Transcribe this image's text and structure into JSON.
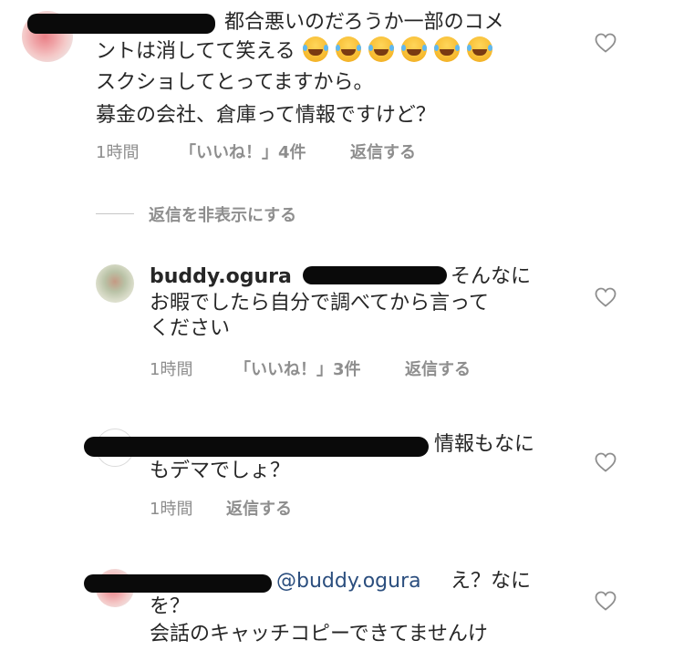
{
  "comment1": {
    "text_line1": "都合悪いのだろうか一部のコメ",
    "text_line2": "ントは消してて笑える",
    "text_line3": "スクショしてとってますから。",
    "text_line4": "募金の会社、倉庫って情報ですけど？",
    "time": "1時間",
    "likes": "「いいね！」4件",
    "reply": "返信する",
    "emoji_icon": "face-with-tears-of-joy"
  },
  "hide_replies": {
    "label": "返信を非表示にする"
  },
  "reply1": {
    "username": "buddy.ogura",
    "text_line1_suffix": "そんなに",
    "text_line2": "お暇でしたら自分で調べてから言って",
    "text_line3": "ください",
    "time": "1時間",
    "likes": "「いいね！」3件",
    "reply": "返信する"
  },
  "reply2": {
    "text_line1_suffix": "情報もなに",
    "text_line2": "もデマでしょ？",
    "time": "1時間",
    "reply": "返信する"
  },
  "reply3": {
    "mention": "@buddy.ogura",
    "text_line1_suffix": "え？なに",
    "text_line2": "を？",
    "text_line3": "会話のキャッチコピーできてませんけ"
  },
  "colors": {
    "text": "#262626",
    "meta": "#8e8e8e",
    "mention": "#2b4e7e",
    "heart_stroke": "#8e8e8e"
  }
}
